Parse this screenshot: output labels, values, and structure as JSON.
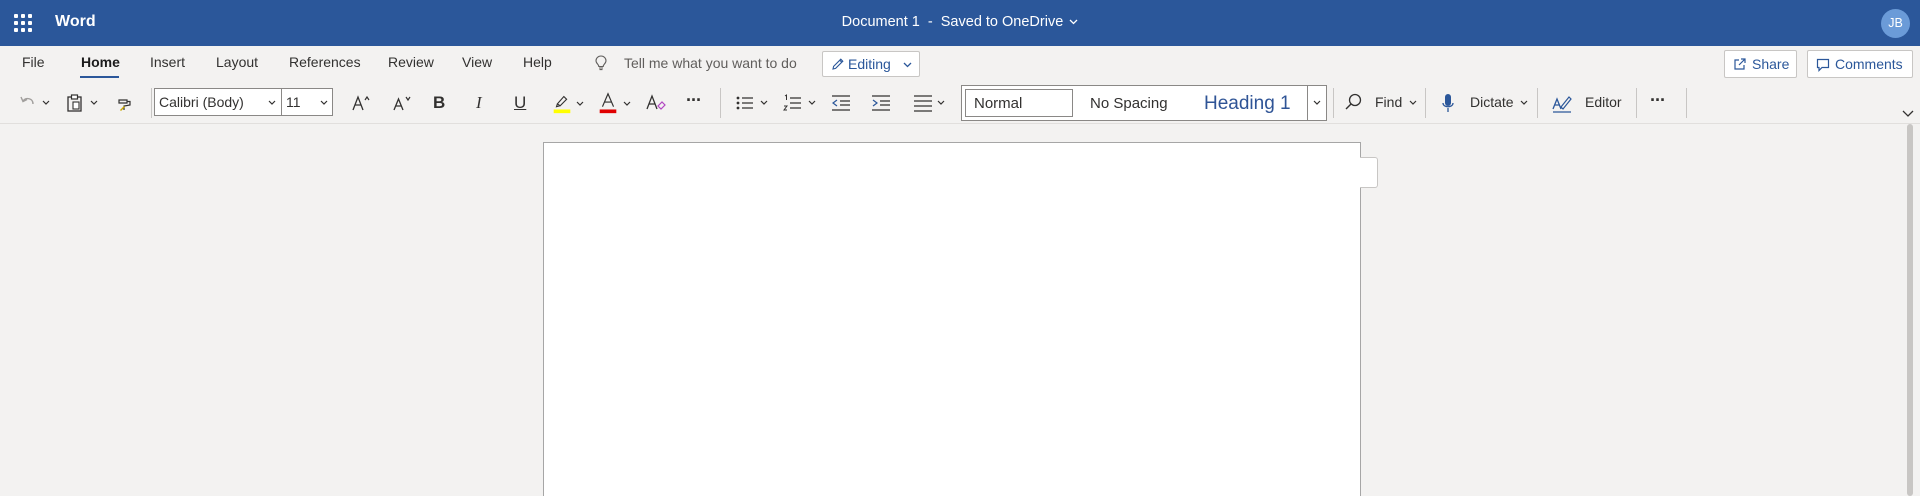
{
  "titlebar": {
    "app_name": "Word",
    "doc_name": "Document 1",
    "separator": "-",
    "save_status": "Saved to OneDrive",
    "user_initials": "JB",
    "background_color": "#2b579a"
  },
  "menu": {
    "tabs": [
      {
        "label": "File"
      },
      {
        "label": "Home",
        "active": true
      },
      {
        "label": "Insert"
      },
      {
        "label": "Layout"
      },
      {
        "label": "References"
      },
      {
        "label": "Review"
      },
      {
        "label": "View"
      },
      {
        "label": "Help"
      }
    ],
    "tell_me_placeholder": "Tell me what you want to do",
    "editing_label": "Editing",
    "share_label": "Share",
    "comments_label": "Comments"
  },
  "ribbon": {
    "font_name": "Calibri (Body)",
    "font_size": "11",
    "bold_glyph": "B",
    "italic_glyph": "I",
    "underline_glyph": "U",
    "more_glyph": "···",
    "styles": {
      "normal": "Normal",
      "no_spacing": "No Spacing",
      "heading1": "Heading 1"
    },
    "find_label": "Find",
    "dictate_label": "Dictate",
    "editor_label": "Editor",
    "highlight_color": "#ffff00",
    "font_color": "#e00000"
  },
  "icons": [
    "app-launcher-icon",
    "lightbulb-icon",
    "pencil-icon",
    "share-icon",
    "comment-icon",
    "undo-icon",
    "clipboard-icon",
    "format-painter-icon",
    "grow-font-icon",
    "shrink-font-icon",
    "highlight-icon",
    "font-color-icon",
    "clear-formatting-icon",
    "bullets-icon",
    "numbering-icon",
    "decrease-indent-icon",
    "increase-indent-icon",
    "align-icon",
    "search-icon",
    "microphone-icon",
    "editor-icon",
    "more-icon"
  ]
}
